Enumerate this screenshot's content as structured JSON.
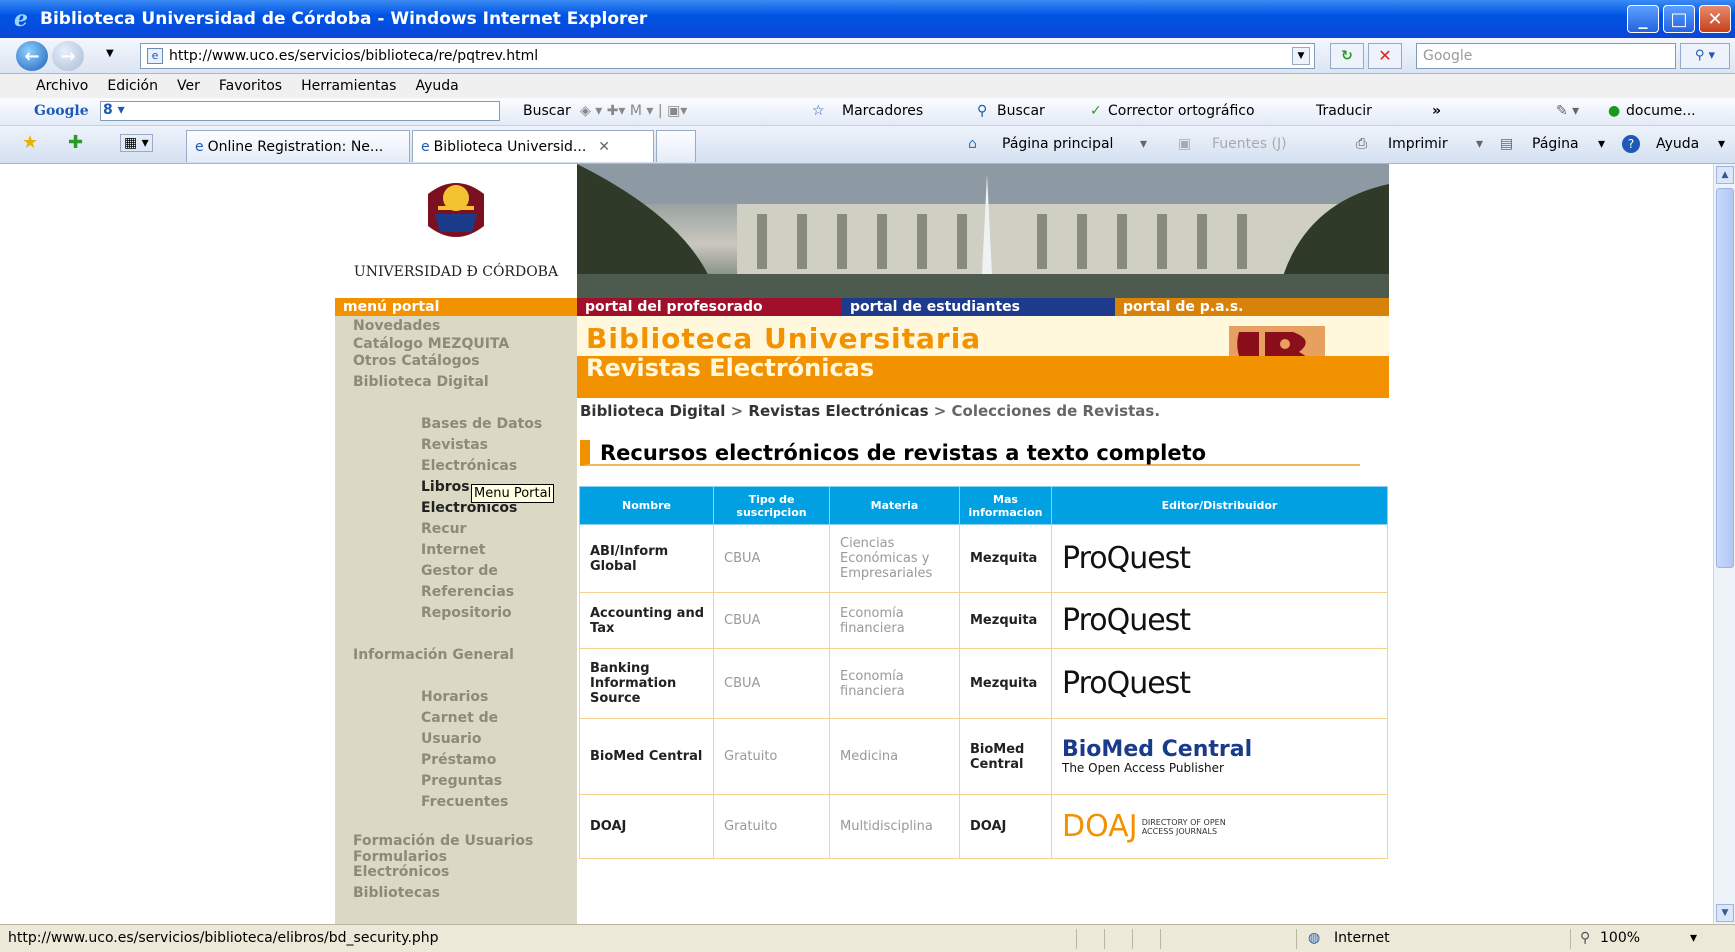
{
  "window": {
    "title": "Biblioteca Universidad de Córdoba - Windows Internet Explorer"
  },
  "address": {
    "url": "http://www.uco.es/servicios/biblioteca/re/pqtrev.html",
    "search_placeholder": "Google"
  },
  "menubar": [
    "Archivo",
    "Edición",
    "Ver",
    "Favoritos",
    "Herramientas",
    "Ayuda"
  ],
  "google_toolbar": {
    "logo": "Google",
    "buscar": "Buscar",
    "marcadores": "Marcadores",
    "buscar2": "Buscar",
    "corrector": "Corrector ortográfico",
    "traducir": "Traducir",
    "docs": "docume..."
  },
  "tabs": [
    {
      "label": "Online Registration: Ne..."
    },
    {
      "label": "Biblioteca Universid..."
    }
  ],
  "command_bar": {
    "home": "Página principal",
    "feeds": "Fuentes (J)",
    "print": "Imprimir",
    "page": "Página",
    "help": "Ayuda"
  },
  "page": {
    "logo_text": "UNIVERSIDAD Đ CÓRDOBA",
    "portal_bar": {
      "menu": "menú portal",
      "profesorado": "portal del profesorado",
      "estudiantes": "portal de estudiantes",
      "pas": "portal de p.a.s."
    },
    "sidebar": {
      "novedades": "Novedades",
      "catalogo": "Catálogo MEZQUITA",
      "otros": "Otros Catálogos",
      "biblioteca_digital": "Biblioteca Digital",
      "bases": "Bases de Datos",
      "revistas": "Revistas",
      "electronicas": "Electrónicas",
      "libros": "Libros",
      "libros_elec": "Electrónicos",
      "recursos": "Recur",
      "internet": "Internet",
      "gestor": "Gestor de",
      "referencias": "Referencias",
      "repositorio": "Repositorio",
      "info_general": "Información General",
      "horarios": "Horarios",
      "carnet": "Carnet de",
      "usuario": "Usuario",
      "prestamo": "Préstamo",
      "preguntas": "Preguntas",
      "frecuentes": "Frecuentes",
      "formacion": "Formación de Usuarios",
      "formularios": "Formularios",
      "form_elec": "Electrónicos",
      "bibliotecas": "Bibliotecas"
    },
    "tooltip": "Menu Portal",
    "header_title": "Biblioteca Universitaria",
    "subheader": "Revistas Electrónicas",
    "breadcrumb": {
      "a": "Biblioteca Digital",
      "sep1": " > ",
      "b": "Revistas Electrónicas",
      "sep2": " > ",
      "c": "Colecciones de Revistas."
    },
    "section_title": "Recursos electrónicos de revistas a texto completo",
    "table": {
      "headers": [
        "Nombre",
        "Tipo de suscripcion",
        "Materia",
        "Mas informacion",
        "Editor/Distribuidor"
      ],
      "rows": [
        {
          "nombre": "ABI/Inform Global",
          "tipo": "CBUA",
          "materia": "Ciencias Económicas y Empresariales",
          "mas": "Mezquita",
          "editor": "ProQuest"
        },
        {
          "nombre": "Accounting and Tax",
          "tipo": "CBUA",
          "materia": "Economía financiera",
          "mas": "Mezquita",
          "editor": "ProQuest"
        },
        {
          "nombre": "Banking Information Source",
          "tipo": "CBUA",
          "materia": "Economía financiera",
          "mas": "Mezquita",
          "editor": "ProQuest"
        },
        {
          "nombre": "BioMed Central",
          "tipo": "Gratuito",
          "materia": "Medicina",
          "mas": "BioMed Central",
          "editor": "BioMed Central"
        },
        {
          "nombre": "DOAJ",
          "tipo": "Gratuito",
          "materia": "Multidisciplina",
          "mas": "DOAJ",
          "editor": "DOAJ"
        }
      ],
      "biomed_sub": "The Open Access Publisher",
      "doaj_sub": "DIRECTORY OF OPEN ACCESS JOURNALS"
    }
  },
  "status": {
    "url": "http://www.uco.es/servicios/biblioteca/elibros/bd_security.php",
    "zone": "Internet",
    "zoom": "100%"
  }
}
